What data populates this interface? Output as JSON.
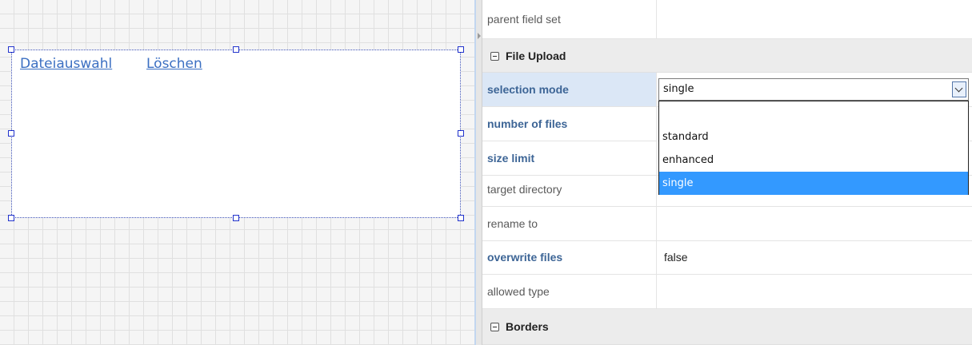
{
  "canvas": {
    "upload_links": [
      "Dateiauswahl",
      "Löschen"
    ]
  },
  "properties": {
    "parent_field_set": {
      "name": "parent field set",
      "value": ""
    },
    "file_upload_section": "File Upload",
    "selection_mode": {
      "name": "selection mode",
      "value": "single"
    },
    "number_of_files": {
      "name": "number of files",
      "value": ""
    },
    "size_limit": {
      "name": "size limit",
      "value": ""
    },
    "target_directory": {
      "name": "target directory",
      "value": ""
    },
    "rename_to": {
      "name": "rename to",
      "value": ""
    },
    "overwrite_files": {
      "name": "overwrite files",
      "value": "false"
    },
    "allowed_type": {
      "name": "allowed type",
      "value": ""
    },
    "borders_section": "Borders"
  },
  "dropdown": {
    "options": [
      "",
      "standard",
      "enhanced",
      "single"
    ],
    "selected": "single"
  },
  "icons": {
    "collapse": "collapse-minus-icon",
    "select_arrow": "chevron-down-icon",
    "splitter": "caret-right-icon"
  },
  "colors": {
    "link": "#3b6fc2",
    "selection_handle": "#2233cc",
    "bold_label": "#3d6596",
    "selected_row": "#dbe7f6",
    "dropdown_highlight": "#3399ff"
  }
}
